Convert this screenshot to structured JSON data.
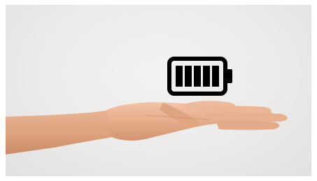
{
  "scene": {
    "subject": "open-palm-hand",
    "icon_name": "battery-full-icon",
    "battery_level": 1.0,
    "battery_bars": 5,
    "background_color": "#ecebe9",
    "skin_color": "#e7b08f",
    "icon_color": "#000000"
  }
}
